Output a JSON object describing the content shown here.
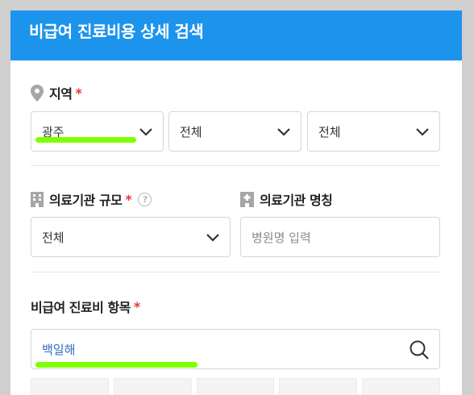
{
  "header": {
    "title": "비급여 진료비용 상세 검색"
  },
  "region": {
    "label": "지역",
    "required_mark": "*",
    "selects": [
      "광주",
      "전체",
      "전체"
    ]
  },
  "scale": {
    "label": "의료기관 규모",
    "required_mark": "*",
    "help_glyph": "?",
    "value": "전체"
  },
  "name": {
    "label": "의료기관 명칭",
    "placeholder": "병원명 입력"
  },
  "item": {
    "label": "비급여 진료비 항목",
    "required_mark": "*",
    "value": "백일해"
  },
  "colors": {
    "header": "#1d94ec",
    "required": "#e0393e",
    "highlight": "#80ff00",
    "item_value": "#2d6bbf"
  },
  "icons": [
    "location-pin-icon",
    "building-icon",
    "hospital-icon",
    "chevron-down-icon",
    "search-icon",
    "help-icon"
  ]
}
